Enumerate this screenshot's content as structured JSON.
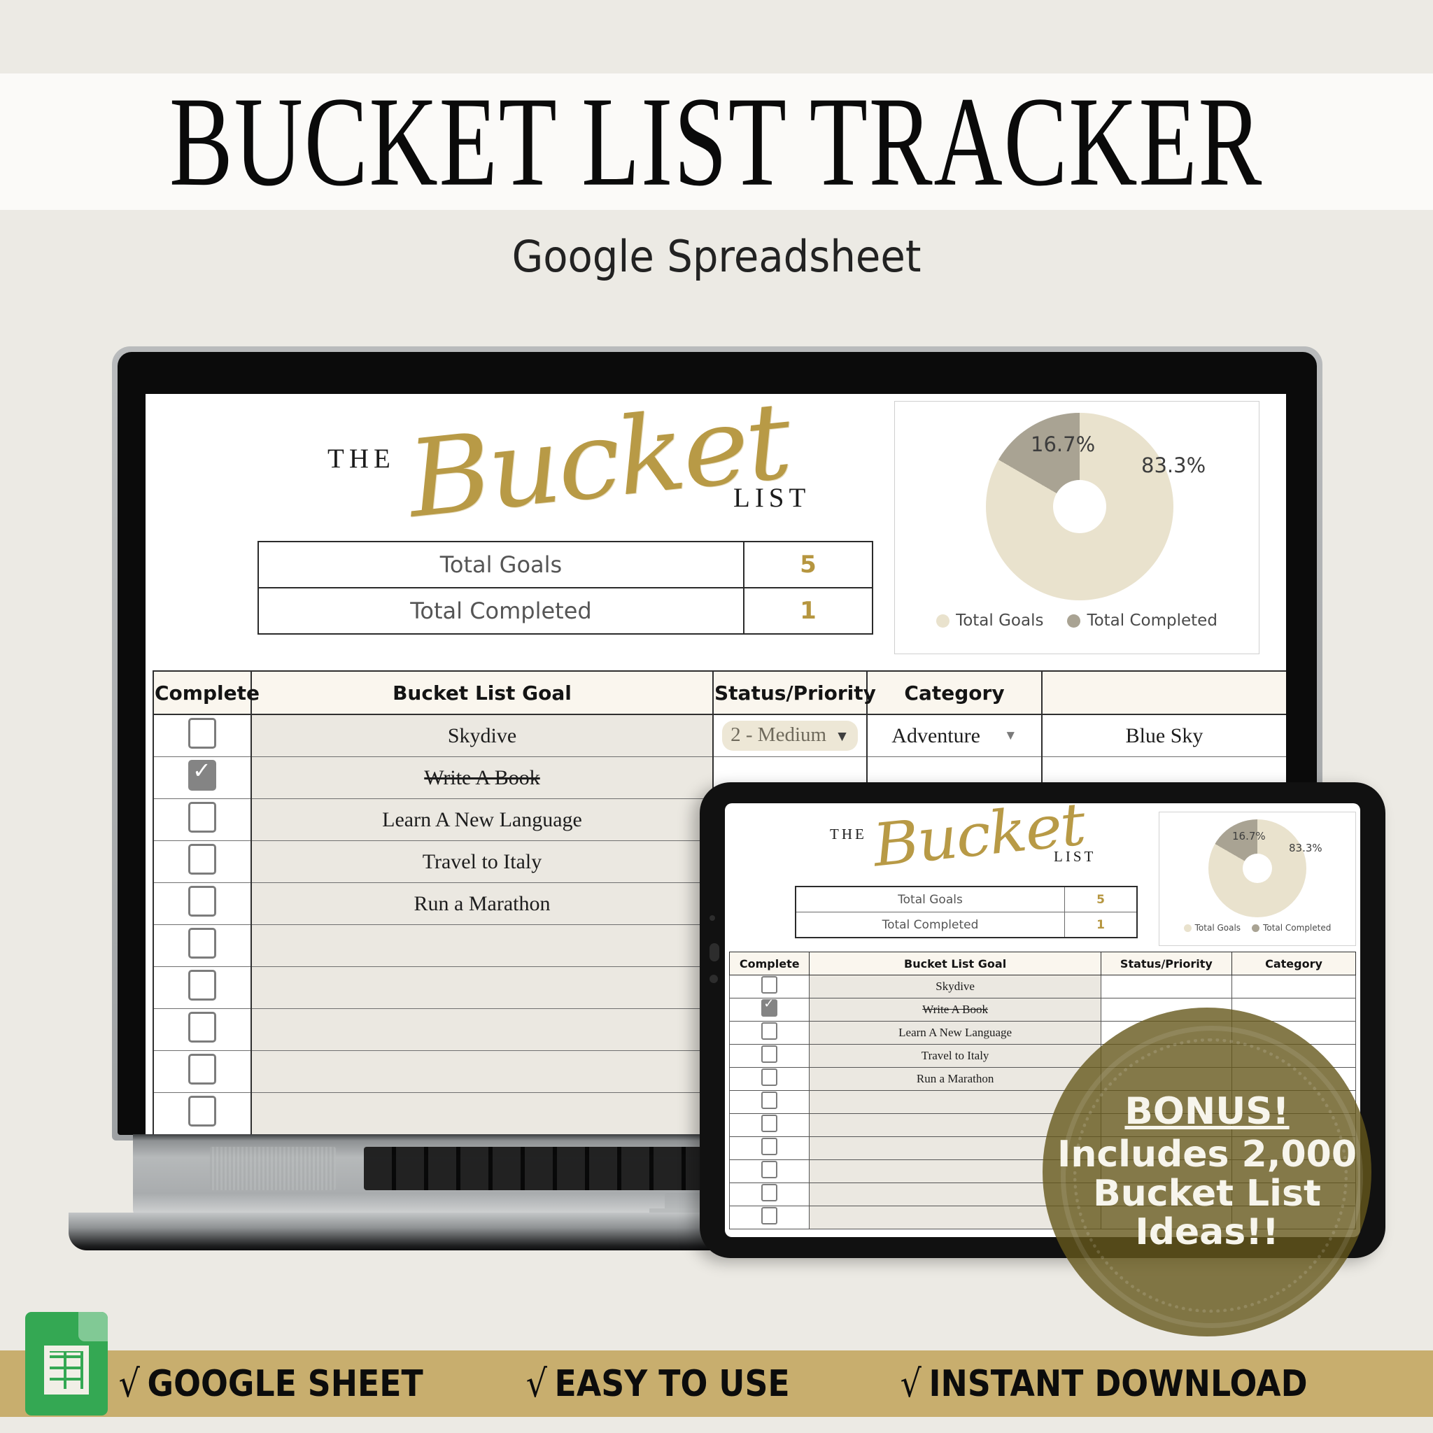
{
  "header": {
    "title": "BUCKET LIST TRACKER",
    "subtitle": "Google Spreadsheet"
  },
  "sheet": {
    "logo": {
      "the": "THE",
      "script": "Bucket",
      "list": "LIST"
    },
    "summary": {
      "rows": [
        {
          "label": "Total Goals",
          "value": "5"
        },
        {
          "label": "Total Completed",
          "value": "1"
        }
      ]
    },
    "table": {
      "headers": [
        "Complete",
        "Bucket List Goal",
        "Status/Priority",
        "Category",
        ""
      ],
      "rows": [
        {
          "complete": false,
          "goal": "Skydive",
          "status": "2 - Medium",
          "category": "Adventure",
          "extra": "Blue Sky"
        },
        {
          "complete": true,
          "goal": "Write A Book",
          "status": "",
          "category": "",
          "extra": ""
        },
        {
          "complete": false,
          "goal": "Learn A New Language",
          "status": "",
          "category": "",
          "extra": ""
        },
        {
          "complete": false,
          "goal": "Travel to Italy",
          "status": "",
          "category": "",
          "extra": ""
        },
        {
          "complete": false,
          "goal": "Run a Marathon",
          "status": "",
          "category": "",
          "extra": ""
        },
        {
          "complete": false,
          "goal": "",
          "status": "",
          "category": "",
          "extra": ""
        },
        {
          "complete": false,
          "goal": "",
          "status": "",
          "category": "",
          "extra": ""
        },
        {
          "complete": false,
          "goal": "",
          "status": "",
          "category": "",
          "extra": ""
        },
        {
          "complete": false,
          "goal": "",
          "status": "",
          "category": "",
          "extra": ""
        },
        {
          "complete": false,
          "goal": "",
          "status": "",
          "category": "",
          "extra": ""
        },
        {
          "complete": false,
          "goal": "",
          "status": "",
          "category": "",
          "extra": ""
        }
      ]
    }
  },
  "chart_data": {
    "type": "pie",
    "title": "",
    "categories": [
      "Total Goals",
      "Total Completed"
    ],
    "values": [
      5,
      1
    ],
    "labels": [
      "83.3%",
      "16.7%"
    ],
    "colors": [
      "#e9e2cd",
      "#a9a393"
    ],
    "legend_position": "bottom",
    "donut": true
  },
  "badge": {
    "line1": "BONUS!",
    "line2": "Includes 2,000",
    "line3": "Bucket List",
    "line4": "Ideas!!",
    "color": "#65581b"
  },
  "footer": {
    "tick": "√",
    "features": [
      "GOOGLE SHEET",
      "EASY TO USE",
      "INSTANT DOWNLOAD"
    ],
    "icon": "google-sheets-icon",
    "bar_color": "#c8ae6e"
  }
}
